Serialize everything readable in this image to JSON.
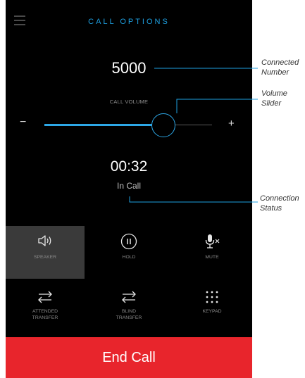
{
  "header": {
    "title": "CALL OPTIONS",
    "menu_icon": "hamburger-menu-icon"
  },
  "call": {
    "number": "5000",
    "timer": "00:32",
    "status": "In Call"
  },
  "volume": {
    "label": "CALL VOLUME",
    "minus": "−",
    "plus": "+",
    "level": 0.71
  },
  "buttons": [
    {
      "label": "SPEAKER",
      "icon": "speaker-icon",
      "active": true
    },
    {
      "label": "HOLD",
      "icon": "pause-icon",
      "active": false
    },
    {
      "label": "MUTE",
      "icon": "mic-mute-icon",
      "active": false
    },
    {
      "label": "ATTENDED TRANSFER",
      "icon": "transfer-icon",
      "active": false
    },
    {
      "label": "BLIND TRANSFER",
      "icon": "transfer-icon",
      "active": false
    },
    {
      "label": "KEYPAD",
      "icon": "keypad-icon",
      "active": false
    }
  ],
  "end_call": {
    "label": "End Call"
  },
  "callouts": {
    "connected_number": [
      "Connected",
      "Number"
    ],
    "volume_slider": [
      "Volume",
      "Slider"
    ],
    "connection_status": [
      "Connection",
      "Status"
    ]
  },
  "colors": {
    "accent": "#2da7e6",
    "end_call": "#e8252c",
    "background": "#000000",
    "active_button": "#3a3a3a"
  }
}
